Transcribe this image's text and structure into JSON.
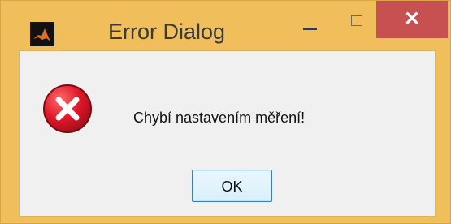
{
  "window": {
    "title": "Error Dialog",
    "controls": {
      "minimize_glyph": "",
      "maximize_glyph": "",
      "close_glyph": "✕"
    },
    "colors": {
      "frame": "#f0be5a",
      "close": "#c75050",
      "client": "#f0f0f0",
      "error_red": "#e0182a"
    }
  },
  "dialog": {
    "icon": "error-x-icon",
    "message": "Chybí nastavením měření!",
    "ok_label": "OK"
  }
}
